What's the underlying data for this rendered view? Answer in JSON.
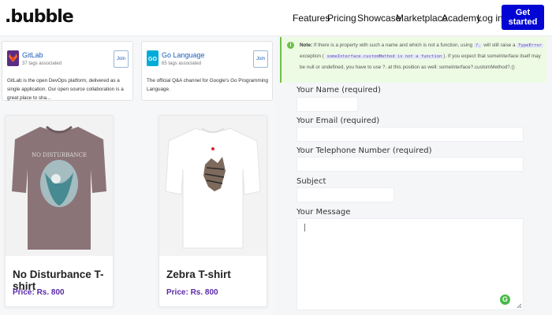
{
  "nav": {
    "logo": ".bubble",
    "links": [
      "Features",
      "Pricing",
      "Showcase",
      "Marketplace",
      "Academy",
      "Log in"
    ],
    "cta": "Get started"
  },
  "communities": [
    {
      "title": "GitLab",
      "subtitle": "37 tags associated",
      "join": "Join",
      "description": "GitLab is the open DevOps platform, delivered as a single application. Our open source collaboration is a great place to sha...",
      "color": "#e24329"
    },
    {
      "title": "Go Language",
      "subtitle": "65 tags associated",
      "join": "Join",
      "description": "The official Q&A channel for Google's Go Programming Language.",
      "color": "#00acd7"
    }
  ],
  "products": [
    {
      "name": "No Disturbance T-shirt",
      "price": "Price: Rs. 800"
    },
    {
      "name": "Zebra T-shirt",
      "price": "Price: Rs. 800"
    }
  ],
  "note": {
    "label": "Note:",
    "part1": "If there is a property with such a name and which is not a function, using",
    "code1": "?.",
    "part2": "will still raise a",
    "code2": "TypeError",
    "part3": "exception (",
    "code3": "someInterface.customMethod is not a function",
    "part4": "). If you expect that someInterface itself may be null or undefined, you have to use ?. at this position as well: someInterface?.customMethod?.()"
  },
  "form": {
    "name_label": "Your Name (required)",
    "email_label": "Your Email (required)",
    "phone_label": "Your Telephone Number (required)",
    "subject_label": "Subject",
    "message_label": "Your Message"
  },
  "colors": {
    "accent": "#0205d3",
    "price": "#5b2aa8",
    "note_green": "#6cc04a"
  }
}
